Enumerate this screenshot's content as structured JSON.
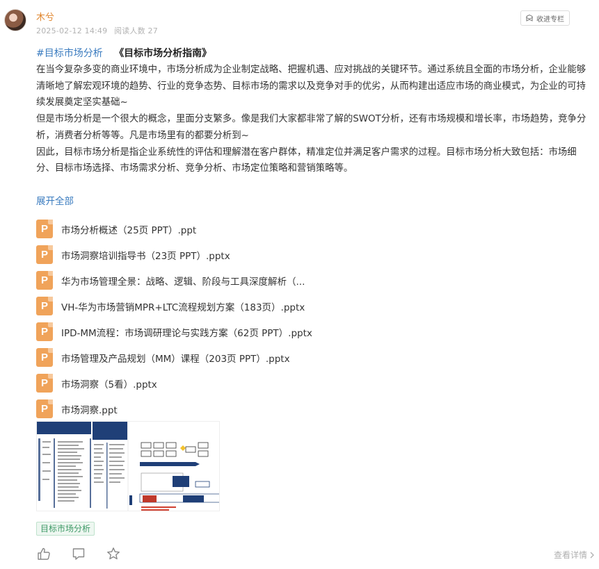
{
  "post": {
    "author": "木兮",
    "date": "2025-02-12 14:49",
    "read_count": "阅读人数 27",
    "collect_label": "收进专栏",
    "topic_tag": "#目标市场分析",
    "title": "《目标市场分析指南》",
    "paragraphs": [
      "在当今复杂多变的商业环境中，市场分析成为企业制定战略、把握机遇、应对挑战的关键环节。通过系统且全面的市场分析，企业能够清晰地了解宏观环境的趋势、行业的竞争态势、目标市场的需求以及竞争对手的优劣，从而构建出适应市场的商业模式，为企业的可持续发展奠定坚实基础~",
      "但是市场分析是一个很大的概念，里面分支繁多。像是我们大家都非常了解的SWOT分析，还有市场规模和增长率，市场趋势，竞争分析，消费者分析等等。凡是市场里有的都要分析到~",
      "因此，目标市场分析是指企业系统性的评估和理解潜在客户群体，精准定位并满足客户需求的过程。目标市场分析大致包括：市场细分、目标市场选择、市场需求分析、竞争分析、市场定位策略和营销策略等。"
    ],
    "expand_label": "展开全部",
    "file_icon_letter": "P",
    "files": [
      "市场分析概述（25页 PPT）.ppt",
      "市场洞察培训指导书（23页 PPT）.pptx",
      "华为市场管理全景：战略、逻辑、阶段与工具深度解析（...",
      "VH-华为市场营销MPR+LTC流程规划方案（183页）.pptx",
      "IPD-MM流程：市场调研理论与实践方案（62页 PPT）.pptx",
      "市场管理及产品规划（MM）课程（203页 PPT）.pptx",
      "市场洞察（5看）.pptx",
      "市场洞察.ppt"
    ],
    "topic_chip": "目标市场分析",
    "detail_link": "查看详情"
  },
  "colors": {
    "author": "#e0862e",
    "link": "#3a7bbf",
    "file_icon": "#f0a35a",
    "chip_text": "#3e9a66",
    "chip_bg": "#eef7f1"
  },
  "icons": [
    "avatar",
    "bookmark-icon",
    "ppt-file-icon",
    "like-icon",
    "comment-icon",
    "star-icon",
    "chevron-right-icon"
  ]
}
